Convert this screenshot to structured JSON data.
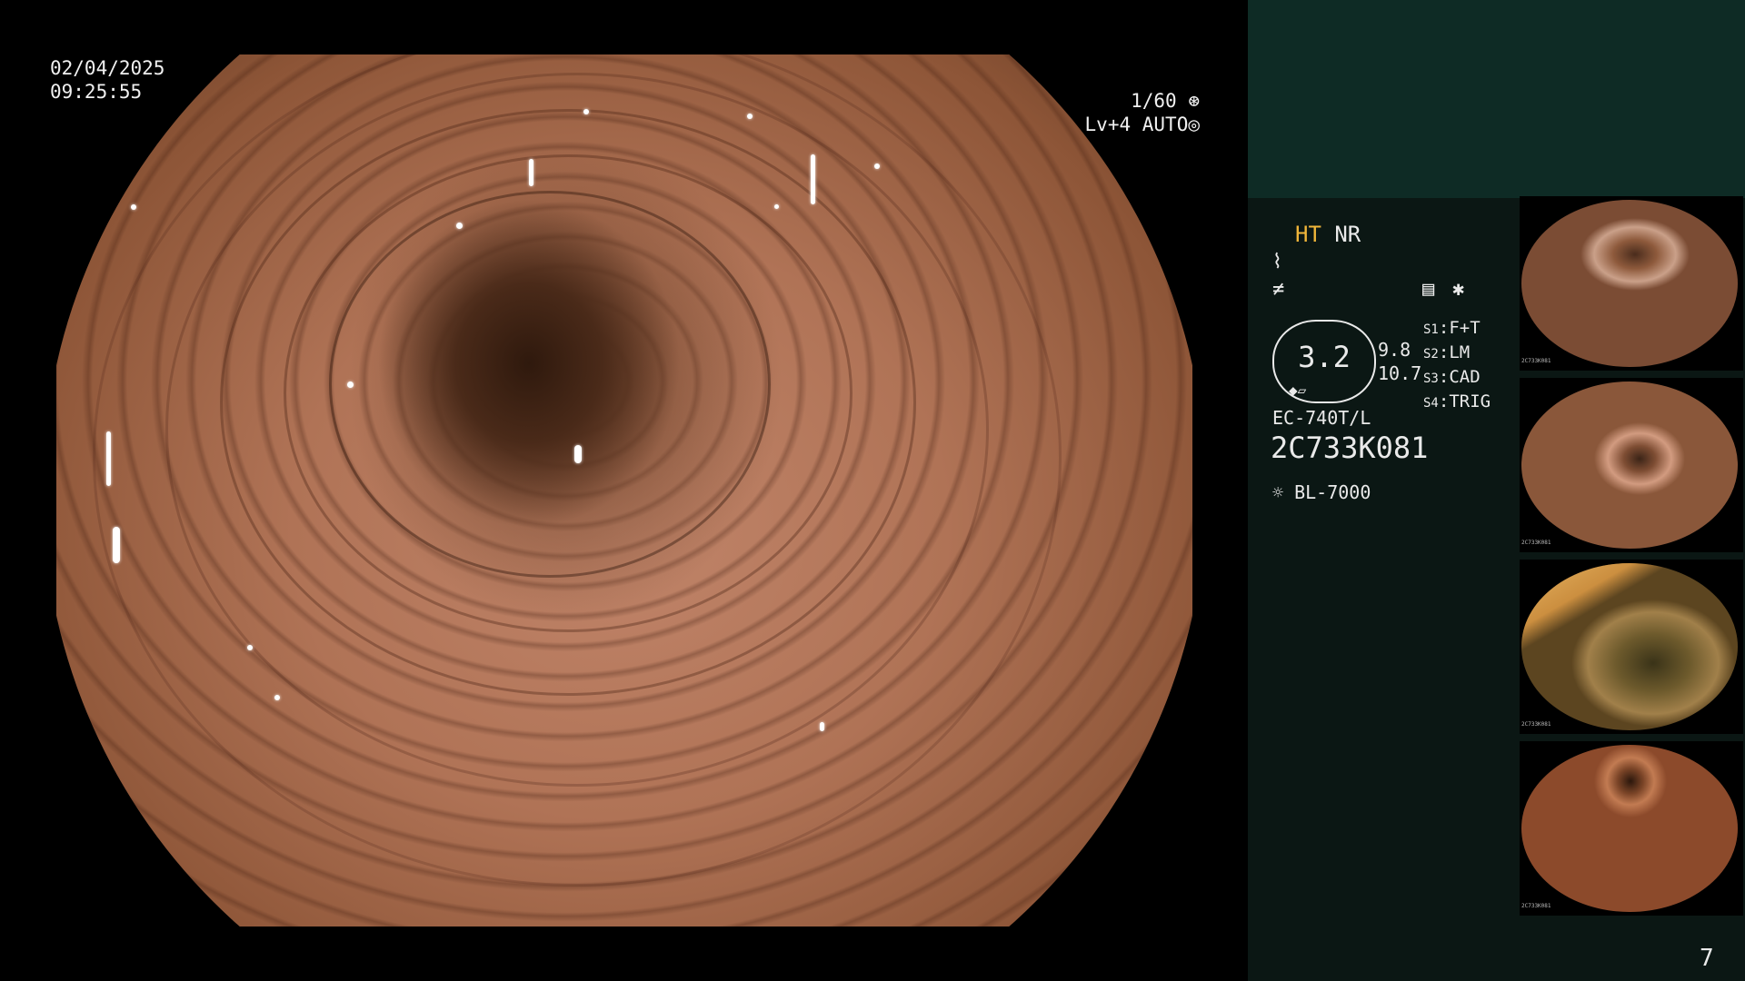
{
  "overlay": {
    "date": "02/04/2025",
    "time": "09:25:55",
    "shutter": "1/60",
    "level": "Lv+4",
    "iris": "AUTO"
  },
  "panel": {
    "mode_ht": "HT",
    "mode_nr": "NR",
    "zoom_value": "3.2",
    "value_top": "9.8",
    "value_bottom": "10.7",
    "switches": [
      {
        "key": "S1",
        "value": "F+T"
      },
      {
        "key": "S2",
        "value": "LM"
      },
      {
        "key": "S3",
        "value": "CAD"
      },
      {
        "key": "S4",
        "value": "TRIG"
      }
    ],
    "scope_model": "EC-740T/L",
    "scope_serial": "2C733K081",
    "light_source": "BL-7000",
    "page_number": "7"
  },
  "thumbnails": [
    {
      "label": "2C733K081"
    },
    {
      "label": "2C733K081"
    },
    {
      "label": "2C733K081"
    },
    {
      "label": "2C733K081"
    }
  ],
  "colors": {
    "ht_accent": "#f0b63a",
    "panel_bg": "#0b1714",
    "panel_top_bg": "#0e2b25"
  }
}
